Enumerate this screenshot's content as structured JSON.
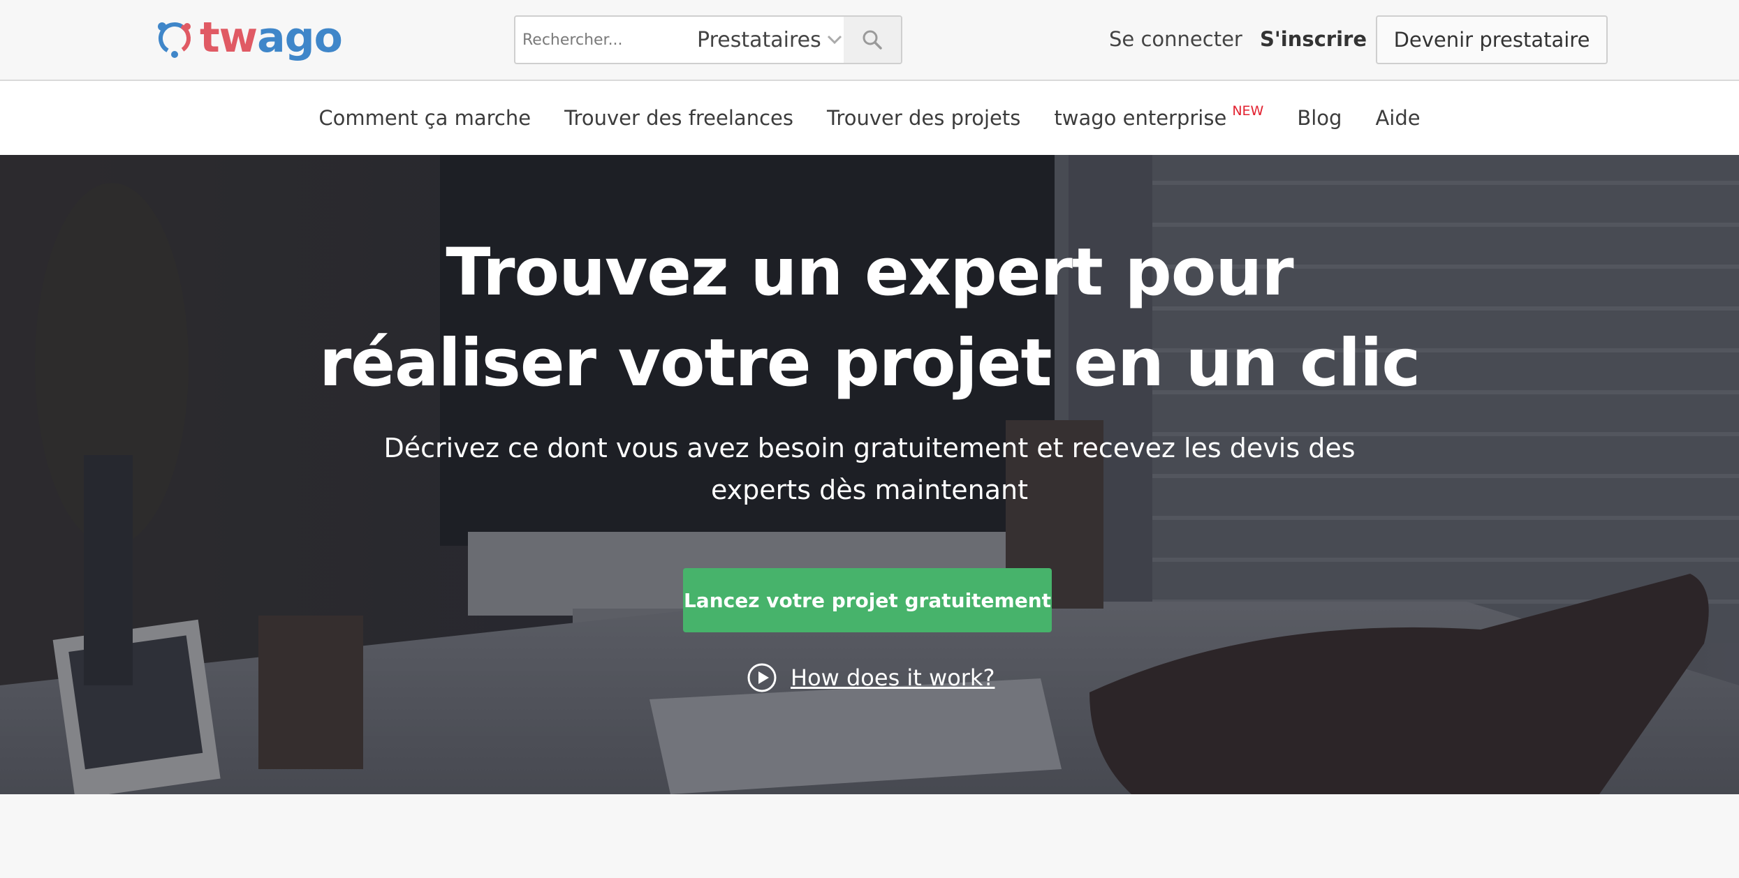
{
  "brand": {
    "name": "twago",
    "name_part1": "tw",
    "name_part2": "ago",
    "color_primary": "#e05a64",
    "color_secondary": "#3f86c9"
  },
  "search": {
    "placeholder": "Rechercher...",
    "category_selected": "Prestataires",
    "search_icon": "search-icon"
  },
  "header": {
    "login_label": "Se connecter",
    "signup_label": "S'inscrire",
    "become_provider_label": "Devenir prestataire"
  },
  "subnav": {
    "items": [
      {
        "label": "Comment ça marche"
      },
      {
        "label": "Trouver des freelances"
      },
      {
        "label": "Trouver des projets"
      },
      {
        "label": "twago enterprise",
        "badge": "NEW"
      },
      {
        "label": "Blog"
      },
      {
        "label": "Aide"
      }
    ],
    "badge_color": "#e2202f"
  },
  "hero": {
    "title_line1": "Trouvez un expert pour",
    "title_line2": "réaliser votre projet en un clic",
    "subtitle_line1": "Décrivez ce dont vous avez besoin gratuitement et recevez les devis des",
    "subtitle_line2": "experts dès maintenant",
    "cta_label": "Lancez votre projet gratuitement",
    "cta_color": "#47b36b",
    "how_label": "How does it work?",
    "how_icon": "play-circle-icon"
  }
}
